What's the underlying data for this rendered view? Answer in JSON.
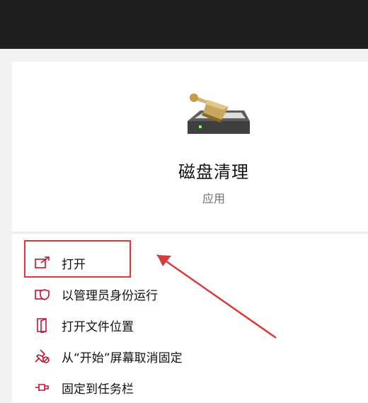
{
  "app": {
    "title": "磁盘清理",
    "type": "应用",
    "icon": "disk-cleanup-icon"
  },
  "menu": {
    "items": [
      {
        "label": "打开",
        "icon": "open-icon"
      },
      {
        "label": "以管理员身份运行",
        "icon": "shield-run-as-admin-icon"
      },
      {
        "label": "打开文件位置",
        "icon": "file-location-icon"
      },
      {
        "label": "从“开始”屏幕取消固定",
        "icon": "unpin-icon"
      },
      {
        "label": "固定到任务栏",
        "icon": "pin-taskbar-icon"
      }
    ]
  },
  "colors": {
    "accent": "#c8102e",
    "annotation": "#d93a3a",
    "topbar": "#1f1f1f"
  }
}
